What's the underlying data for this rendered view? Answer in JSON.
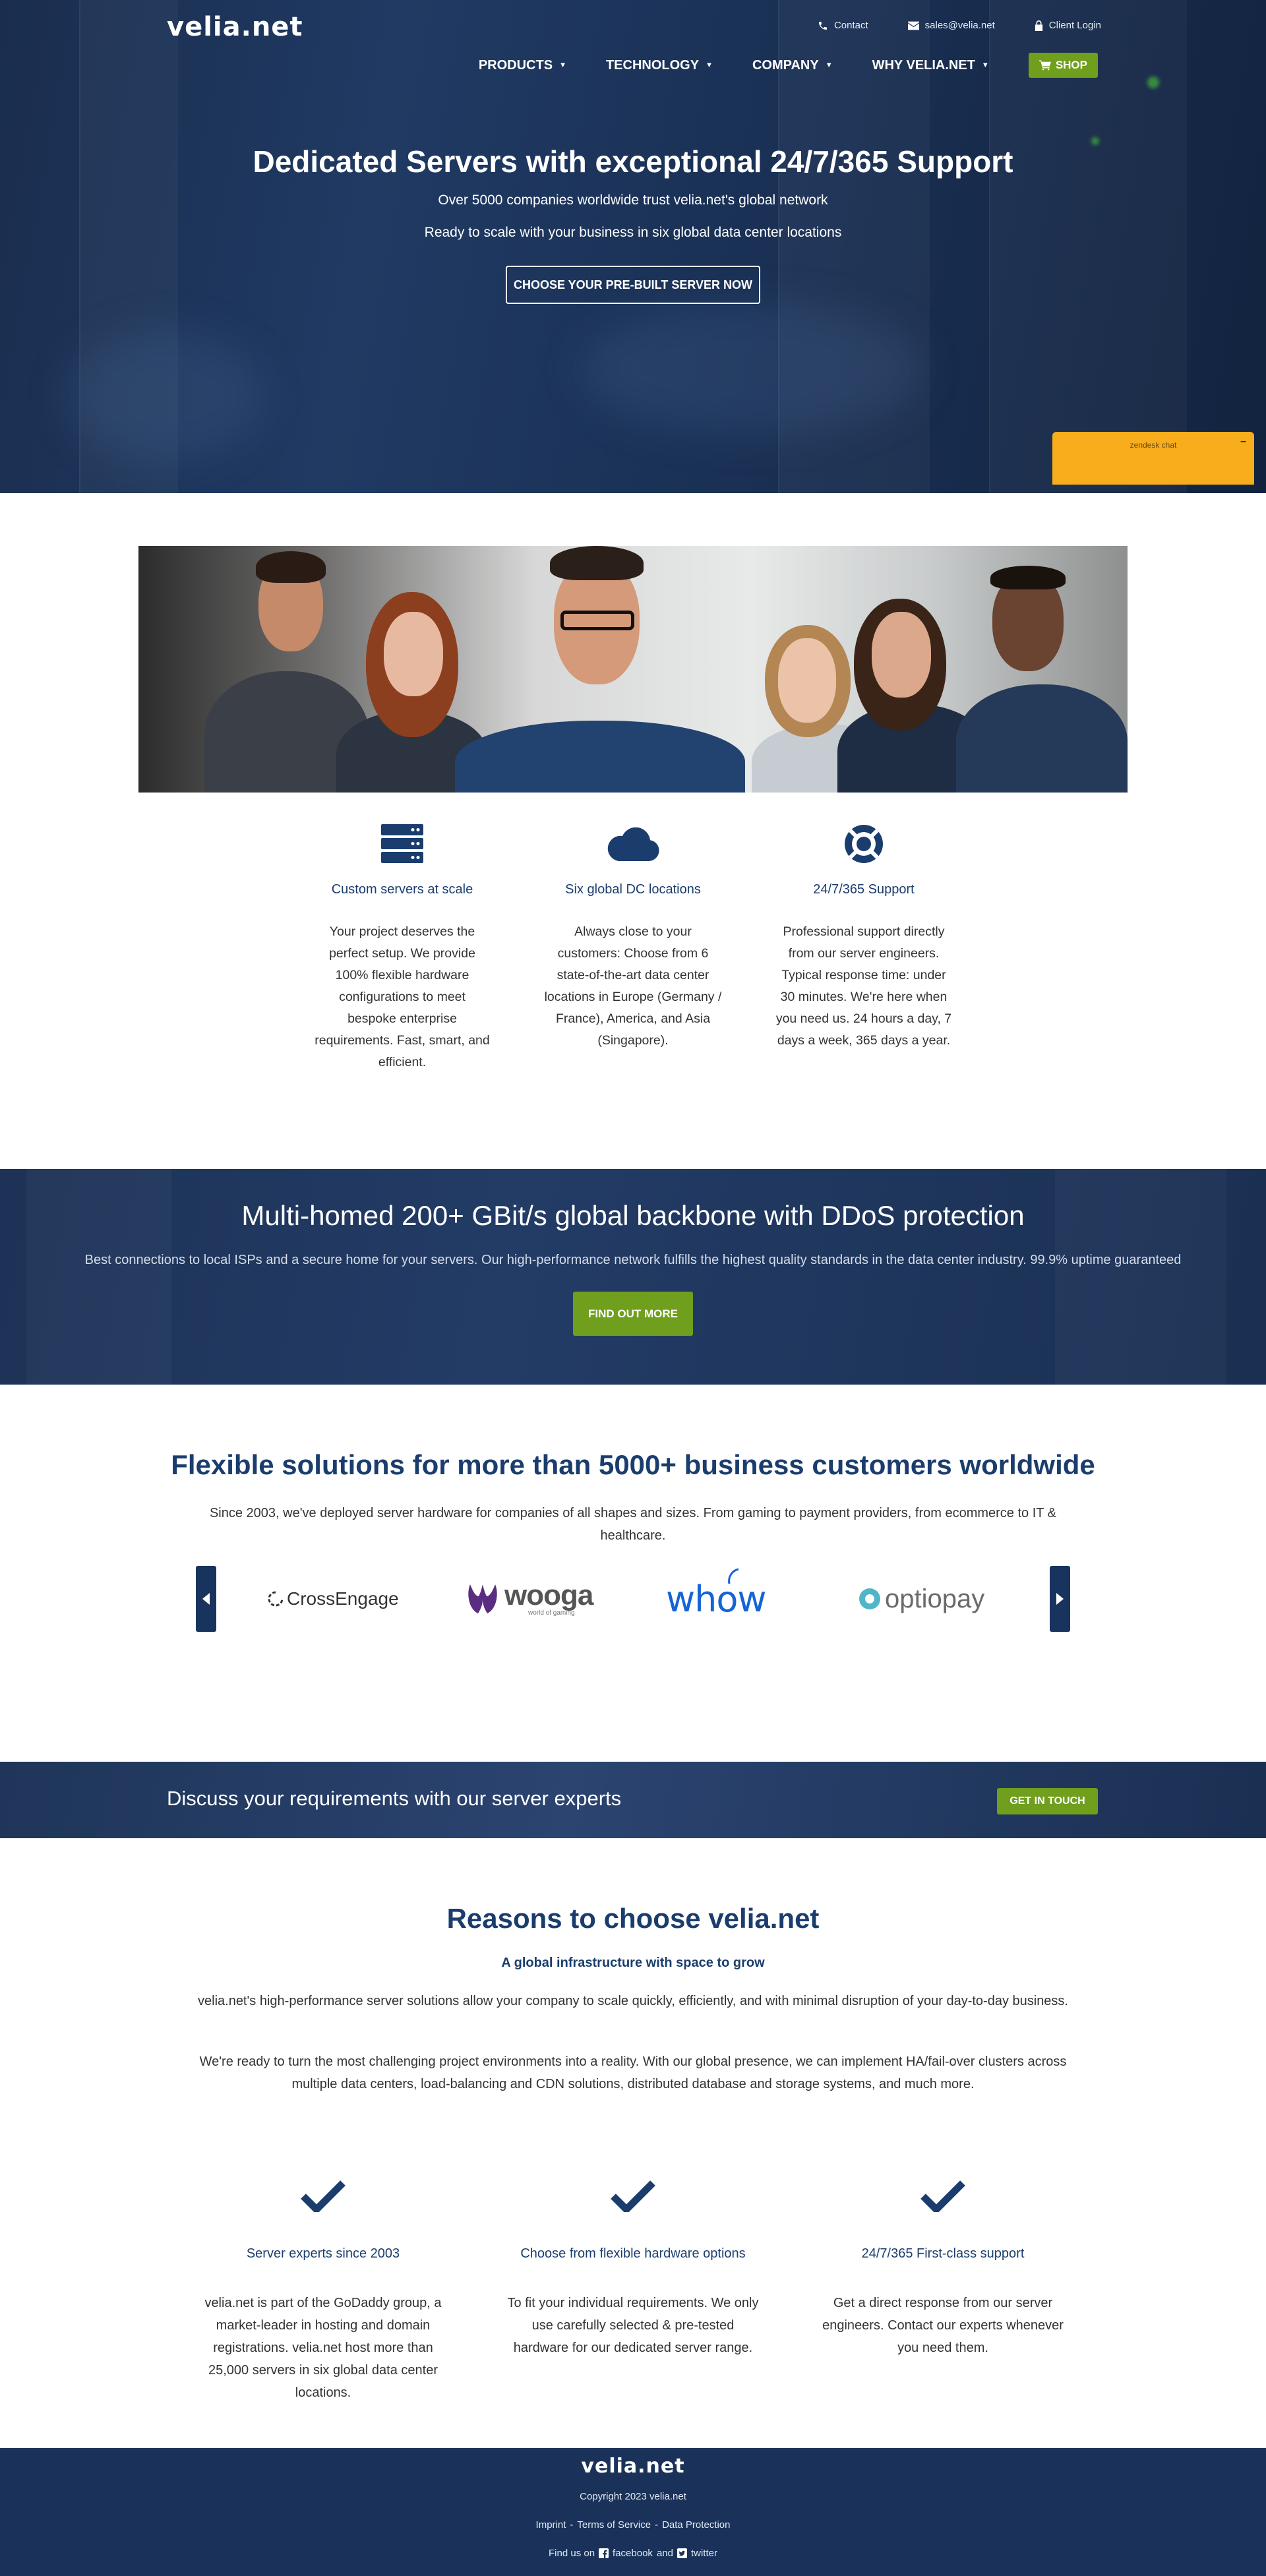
{
  "brand": {
    "logo_text": "velia.net"
  },
  "topbar": {
    "contact": "Contact",
    "email": "sales@velia.net",
    "login": "Client Login"
  },
  "nav": {
    "items": [
      "PRODUCTS",
      "TECHNOLOGY",
      "COMPANY",
      "WHY VELIA.NET"
    ],
    "shop": "SHOP"
  },
  "hero": {
    "title": "Dedicated Servers with exceptional 24/7/365 Support",
    "line1": "Over 5000 companies worldwide trust velia.net's global network",
    "line2": "Ready to scale with your business in six global data center locations",
    "cta": "CHOOSE YOUR PRE-BUILT SERVER NOW"
  },
  "chat": {
    "label": "zendesk chat",
    "minimize": "–"
  },
  "features": [
    {
      "icon": "server-icon",
      "title": "Custom servers at scale",
      "text": "Your project deserves the perfect setup. We provide 100% flexible hardware configurations to meet bespoke enterprise requirements. Fast, smart, and efficient."
    },
    {
      "icon": "cloud-icon",
      "title": "Six global DC locations",
      "text": "Always close to your customers: Choose from 6 state-of-the-art data center locations in Europe (Germany / France), America, and Asia (Singapore)."
    },
    {
      "icon": "lifebuoy-icon",
      "title": "24/7/365 Support",
      "text": "Professional support directly from our server engineers. Typical response time: under 30 minutes. We're here when you need us. 24 hours a day, 7 days a week, 365 days a year."
    }
  ],
  "backbone": {
    "title": "Multi-homed 200+ GBit/s global backbone with DDoS protection",
    "text": "Best connections to local ISPs and a secure home for your servers. Our high-performance network fulfills the highest quality standards in the data center industry. 99.9% uptime guaranteed",
    "cta": "FIND OUT MORE"
  },
  "customers": {
    "title": "Flexible solutions for more than 5000+ business customers worldwide",
    "text": "Since 2003, we've deployed server hardware for companies of all shapes and sizes. From gaming to payment providers, from ecommerce to IT & healthcare.",
    "logos": [
      {
        "name": "CrossEngage"
      },
      {
        "name": "wooga",
        "tagline": "world of gaming"
      },
      {
        "name": "whow"
      },
      {
        "name": "optiopay"
      }
    ]
  },
  "discuss": {
    "text": "Discuss your requirements with our server experts",
    "cta": "GET IN TOUCH"
  },
  "reasons": {
    "title": "Reasons to choose velia.net",
    "subtitle": "A global infrastructure with space to grow",
    "p1": "velia.net's high-performance server solutions allow your company to scale quickly, efficiently, and with minimal disruption of your day-to-day business.",
    "p2": "We're ready to turn the most challenging project environments into a reality. With our global presence, we can implement HA/fail-over clusters across multiple data centers, load-balancing and CDN solutions, distributed database and storage systems, and much more.",
    "columns": [
      {
        "title": "Server experts since 2003",
        "text": "velia.net is part of the GoDaddy group, a market-leader in hosting and domain registrations. velia.net host more than 25,000 servers in six global data center locations."
      },
      {
        "title": "Choose from flexible hardware options",
        "text": "To fit your individual requirements. We only use carefully selected & pre-tested hardware for our dedicated server range."
      },
      {
        "title": "24/7/365 First-class support",
        "text": "Get a direct response from our server engineers. Contact our experts whenever you need them."
      }
    ]
  },
  "footer": {
    "copyright": "Copyright 2023 velia.net",
    "links": [
      "Imprint",
      "Terms of Service",
      "Data Protection"
    ],
    "link_sep": "-",
    "find_us": "Find us on",
    "facebook": "facebook",
    "and": "and",
    "twitter": "twitter"
  },
  "colors": {
    "navy": "#1b3d6d",
    "green": "#6f9f1d",
    "chat": "#f8ad1c",
    "footer": "#1a325a"
  }
}
